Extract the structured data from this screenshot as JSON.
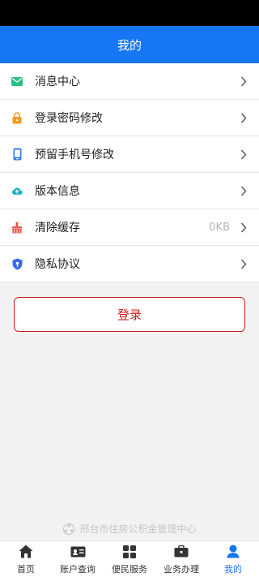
{
  "header": {
    "title": "我的"
  },
  "menu": [
    {
      "label": "消息中心",
      "value": "",
      "icon": "mail-icon",
      "color": "#2bbf83"
    },
    {
      "label": "登录密码修改",
      "value": "",
      "icon": "lock-icon",
      "color": "#f59a23"
    },
    {
      "label": "预留手机号修改",
      "value": "",
      "icon": "phone-icon",
      "color": "#3a7ee8"
    },
    {
      "label": "版本信息",
      "value": "",
      "icon": "cloud-upload-icon",
      "color": "#22b3c4"
    },
    {
      "label": "清除缓存",
      "value": "0KB",
      "icon": "broom-icon",
      "color": "#e8574d"
    },
    {
      "label": "隐私协议",
      "value": "",
      "icon": "shield-icon",
      "color": "#3a6ee8"
    }
  ],
  "login": {
    "label": "登录",
    "color": "#c81e1e"
  },
  "footer": {
    "org_name": "邢台市住房公积金管理中心"
  },
  "tabbar": {
    "active_color": "#1677f5",
    "items": [
      {
        "label": "首页",
        "icon": "home-icon",
        "active": false
      },
      {
        "label": "账户查询",
        "icon": "id-card-icon",
        "active": false
      },
      {
        "label": "便民服务",
        "icon": "grid-icon",
        "active": false
      },
      {
        "label": "业务办理",
        "icon": "briefcase-icon",
        "active": false
      },
      {
        "label": "我的",
        "icon": "user-icon",
        "active": true
      }
    ]
  }
}
